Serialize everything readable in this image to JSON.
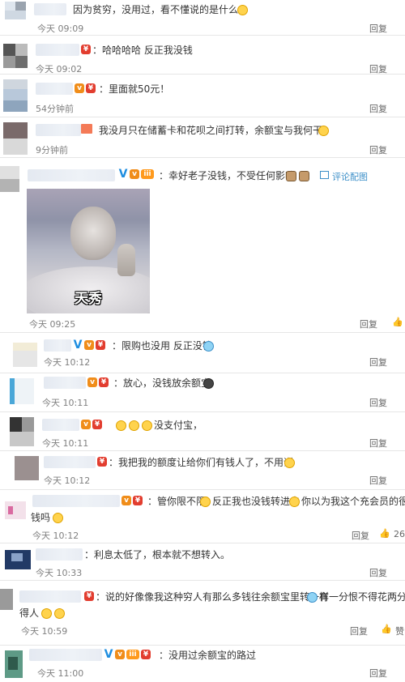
{
  "comments": [
    {
      "text": "因为贫穷，没用过，看不懂说的是什么",
      "time": "今天 09:09",
      "reply": "回复"
    },
    {
      "text": "：哈哈哈哈 反正我没钱",
      "time": "今天 09:02",
      "reply": "回复"
    },
    {
      "text": "：里面就50元！",
      "time": "54分钟前",
      "reply": "回复"
    },
    {
      "text": "我没月只在储蓄卡和花呗之间打转，余额宝与我何干？",
      "time": "9分钟前",
      "reply": "回复"
    },
    {
      "text": "：幸好老子没钱，不受任何影响",
      "view_pic": "评论配图",
      "meme_caption": "天秀",
      "time": "今天 09:25",
      "reply": "回复"
    },
    {
      "text": "：限购也没用 反正没钱",
      "time": "今天 10:12",
      "reply": "回复"
    },
    {
      "text": "：放心，没钱放余额宝",
      "time": "今天 10:11",
      "reply": "回复"
    },
    {
      "text": "没支付宝，",
      "time": "今天 10:11",
      "reply": "回复"
    },
    {
      "text": "：我把我的额度让给你们有钱人了，不用谢",
      "time": "今天 10:12",
      "reply": "回复"
    },
    {
      "text_a": "：管你限不限",
      "text_b": "反正我也没钱转进去",
      "text_c": "你以为我这个充会员的很有",
      "text_d": "钱吗",
      "time": "今天 10:12",
      "reply": "回复",
      "likes": "26"
    },
    {
      "text": "：利息太低了，根本就不想转入。",
      "time": "今天 10:33",
      "reply": "回复"
    },
    {
      "text_a": "：说的好像像我这种穷人有那么多钱往余额宝里转一样",
      "text_b": "有一分恨不得花两分",
      "text_c": "得人",
      "time": "今天 10:59",
      "reply": "回复",
      "like_label": "赞"
    },
    {
      "text": "：没用过余额宝的路过",
      "time": "今天 11:00",
      "reply": "回复"
    }
  ],
  "icons": {
    "like": "thumbs-up-icon",
    "picture": "picture-icon",
    "emoji": "emoji-face-icon",
    "verified": "verified-v-icon",
    "red_packet": "red-packet-badge",
    "vip": "vip-badge"
  },
  "colors": {
    "link": "#3c8fc8",
    "divider": "#e6e6e6",
    "time": "#808080",
    "verified": "#1f8ee0"
  }
}
